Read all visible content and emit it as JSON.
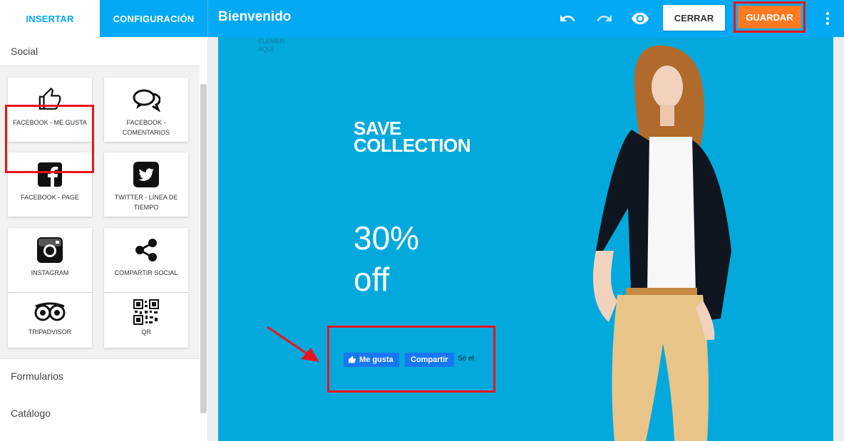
{
  "tabs": {
    "insert": "INSERTAR",
    "config": "CONFIGURACIÓN"
  },
  "header": {
    "title": "Bienvenido",
    "close_label": "CERRAR",
    "save_label": "GUARDAR"
  },
  "sidebar": {
    "sections": {
      "social": "Social",
      "forms": "Formularios",
      "catalog": "Catálogo"
    },
    "widgets": [
      {
        "label": "FACEBOOK - ME GUSTA",
        "icon": "thumbs-up-icon"
      },
      {
        "label": "FACEBOOK - COMENTARIOS",
        "icon": "comments-icon"
      },
      {
        "label": "FACEBOOK - PAGE",
        "icon": "facebook-icon"
      },
      {
        "label": "TWITTER - LÍNEA DE TIEMPO",
        "icon": "twitter-icon"
      },
      {
        "label": "INSTAGRAM",
        "icon": "instagram-icon"
      },
      {
        "label": "COMPARTIR SOCIAL",
        "icon": "share-icon"
      },
      {
        "label": "TRIPADVISOR",
        "icon": "tripadvisor-icon"
      },
      {
        "label": "QR",
        "icon": "qr-code-icon"
      }
    ]
  },
  "canvas": {
    "placeholder_line1": "ELEMEN",
    "placeholder_line2": "AQUÍ",
    "headline_line1": "SAVE",
    "headline_line2": "COLLECTION",
    "discount_line1": "30%",
    "discount_line2": "off",
    "fb_like_label": "Me gusta",
    "fb_share_label": "Compartir",
    "fb_note": "Sé el"
  },
  "colors": {
    "topbar": "#03a9f4",
    "canvas_bg": "#03a9dc",
    "save_button": "#ff7a22",
    "highlight": "#e8141b",
    "facebook_blue": "#1877f2"
  }
}
